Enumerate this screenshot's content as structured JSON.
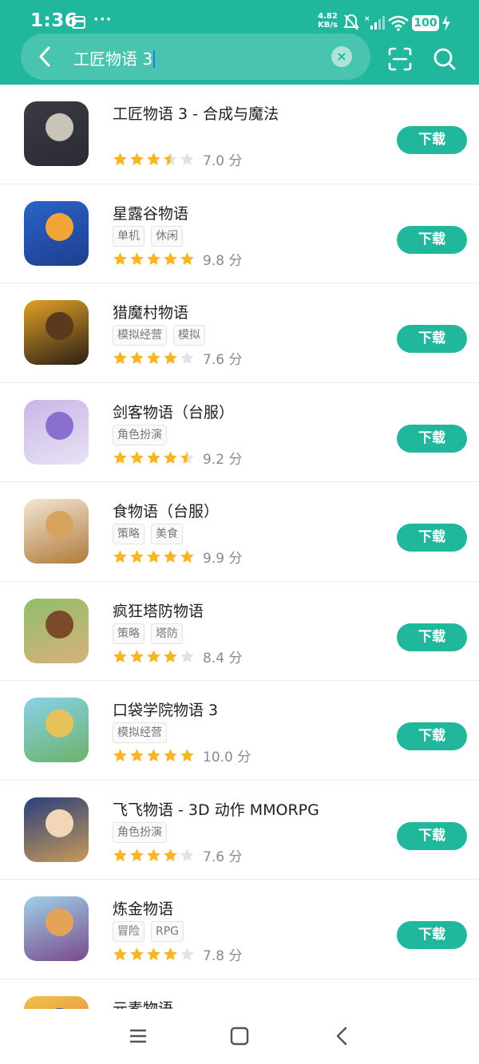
{
  "status": {
    "time": "1:36",
    "speed_value": "4.82",
    "speed_unit": "KB/s",
    "battery": "100"
  },
  "search": {
    "query": "工匠物语 3",
    "clear_symbol": "×"
  },
  "download_label": "下载",
  "apps": [
    {
      "title": "工匠物语 3 - 合成与魔法",
      "tags": [],
      "rating": 3.5,
      "score": "7.0 分",
      "palette": [
        "#3b3a44",
        "#c9c3b8",
        "#2a2b33"
      ]
    },
    {
      "title": "星露谷物语",
      "tags": [
        "单机",
        "休闲"
      ],
      "rating": 5,
      "score": "9.8 分",
      "palette": [
        "#2a63c7",
        "#f0a43a",
        "#1d3f8f"
      ]
    },
    {
      "title": "猎魔村物语",
      "tags": [
        "模拟经营",
        "模拟"
      ],
      "rating": 4,
      "score": "7.6 分",
      "palette": [
        "#e0a126",
        "#5a3a1e",
        "#2c1f14"
      ]
    },
    {
      "title": "剑客物语（台服）",
      "tags": [
        "角色扮演"
      ],
      "rating": 4.5,
      "score": "9.2 分",
      "palette": [
        "#c7b7e6",
        "#8b6fd0",
        "#e9e2f5"
      ]
    },
    {
      "title": "食物语（台服）",
      "tags": [
        "策略",
        "美食"
      ],
      "rating": 5,
      "score": "9.9 分",
      "palette": [
        "#f2e7d4",
        "#d6a45e",
        "#b07a3a"
      ]
    },
    {
      "title": "疯狂塔防物语",
      "tags": [
        "策略",
        "塔防"
      ],
      "rating": 4,
      "score": "8.4 分",
      "palette": [
        "#8fbf6a",
        "#7a4a2a",
        "#d9b07a"
      ]
    },
    {
      "title": "口袋学院物语 3",
      "tags": [
        "模拟经营"
      ],
      "rating": 5,
      "score": "10.0 分",
      "palette": [
        "#8ad0e8",
        "#e7c25a",
        "#6ab36a"
      ]
    },
    {
      "title": "飞飞物语 - 3D 动作 MMORPG",
      "tags": [
        "角色扮演"
      ],
      "rating": 4,
      "score": "7.6 分",
      "palette": [
        "#2a3f7a",
        "#f1d6b8",
        "#c79a5a"
      ]
    },
    {
      "title": "炼金物语",
      "tags": [
        "冒险",
        "RPG"
      ],
      "rating": 4,
      "score": "7.8 分",
      "palette": [
        "#9fd0e8",
        "#e3a45a",
        "#7a4a8a"
      ]
    },
    {
      "title": "元素物语",
      "tags": [],
      "rating": 0,
      "score": "",
      "palette": [
        "#f2c14a",
        "#3a5aa8",
        "#e07a3a"
      ]
    }
  ],
  "colors": {
    "accent": "#21b79d",
    "star": "#f7b520",
    "star_empty": "#e3e3e3"
  },
  "icons": {
    "back": "chevron-left-icon",
    "scan": "scan-icon",
    "search": "search-icon",
    "menu": "menu-icon",
    "home": "home-square-icon",
    "nav_back": "nav-back-icon"
  }
}
